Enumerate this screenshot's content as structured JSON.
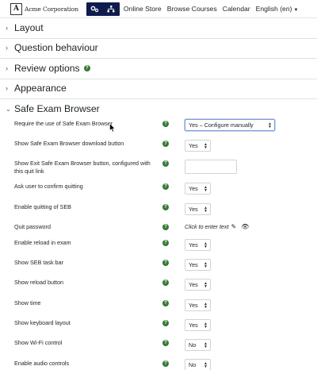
{
  "navbar": {
    "brand_mark": "A",
    "brand_name": "Acme Corporation",
    "icons": [
      "gears-icon",
      "sitemap-icon"
    ],
    "links": [
      "Online Store",
      "Browse Courses",
      "Calendar",
      "English (en)"
    ]
  },
  "sections": {
    "layout": "Layout",
    "question_behaviour": "Question behaviour",
    "review_options": "Review options",
    "appearance": "Appearance",
    "seb": "Safe Exam Browser"
  },
  "colors": {
    "navbar_icon_bg": "#0f1b4d",
    "help_green": "#357a32",
    "focus_border": "#7d9bd6"
  },
  "settings": {
    "require_seb": {
      "label": "Require the use of Safe Exam Browser",
      "value": "Yes – Configure manually"
    },
    "download_btn": {
      "label": "Show Safe Exam Browser download button",
      "value": "Yes"
    },
    "exit_btn": {
      "label": "Show Exit Safe Exam Browser button, configured with this quit link",
      "value": ""
    },
    "confirm_quit": {
      "label": "Ask user to confirm quitting",
      "value": "Yes"
    },
    "enable_quit": {
      "label": "Enable quitting of SEB",
      "value": "Yes"
    },
    "quit_password": {
      "label": "Quit password",
      "value": "Click to enter text"
    },
    "reload_exam": {
      "label": "Enable reload in exam",
      "value": "Yes"
    },
    "task_bar": {
      "label": "Show SEB task bar",
      "value": "Yes"
    },
    "reload_button": {
      "label": "Show reload button",
      "value": "Yes"
    },
    "show_time": {
      "label": "Show time",
      "value": "Yes"
    },
    "keyboard_layout": {
      "label": "Show keyboard layout",
      "value": "Yes"
    },
    "wifi_control": {
      "label": "Show Wi-Fi control",
      "value": "No"
    },
    "audio_controls": {
      "label": "Enable audio controls",
      "value": "No"
    }
  }
}
